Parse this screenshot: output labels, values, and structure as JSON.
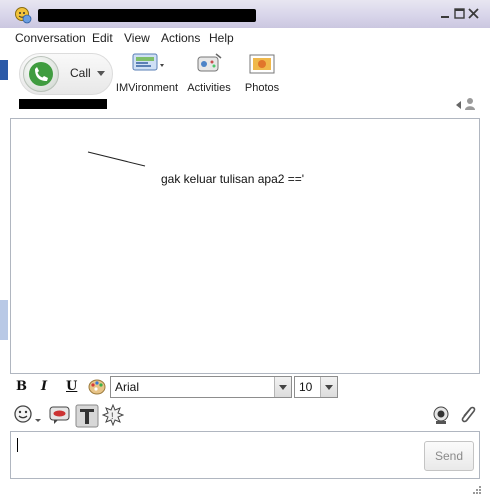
{
  "window": {
    "title_redacted": true
  },
  "menu": {
    "items": [
      "Conversation",
      "Edit",
      "View",
      "Actions",
      "Help"
    ]
  },
  "toolbar": {
    "call_label": "Call",
    "imvironment_label": "IMVironment",
    "activities_label": "Activities",
    "photos_label": "Photos"
  },
  "contact": {
    "name_redacted": true
  },
  "conversation": {
    "annotation": "gak keluar tulisan apa2 =='"
  },
  "format": {
    "bold": "B",
    "italic": "I",
    "underline": "U",
    "font_value": "Arial",
    "size_value": "10"
  },
  "input": {
    "value": "",
    "send_label": "Send"
  },
  "colors": {
    "title_bar": "#d8d5ea",
    "redaction": "#000000",
    "send_disabled_text": "#8a8a8a"
  }
}
